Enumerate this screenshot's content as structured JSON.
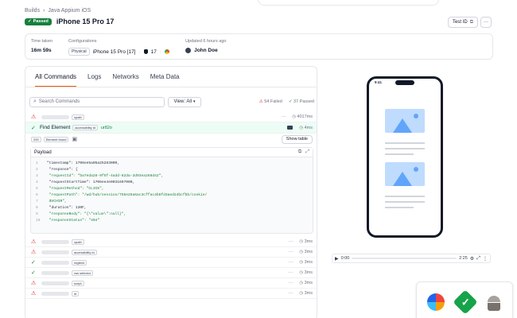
{
  "breadcrumb": {
    "root": "Builds",
    "sep": "›",
    "current": "Java Appium iOS"
  },
  "header": {
    "status": "Passed",
    "title": "iPhone 15 Pro 17",
    "test_id_label": "Test ID",
    "more": "···"
  },
  "stats": {
    "time_taken": {
      "label": "Time taken",
      "value": "16m 59s"
    },
    "configurations": {
      "label": "Configurations",
      "chip": "Physical",
      "device": "iPhone 15 Pro [17]",
      "os": "17"
    },
    "updated": {
      "label": "Updated 6 hours ago",
      "user": "John Doe"
    }
  },
  "tabs": [
    "All Commands",
    "Logs",
    "Networks",
    "Meta Data"
  ],
  "toolbar": {
    "search_placeholder": "Search Commands",
    "view_label": "View: All",
    "failed": "54 Failed",
    "passed": "37 Passed"
  },
  "colors": {
    "accent": "#ea580c",
    "pass": "#15803d",
    "fail": "#dc2626"
  },
  "rows_top": [
    {
      "status": "fail",
      "tag": "xpath",
      "time": "4017ms"
    }
  ],
  "highlight_row": {
    "status": "pass",
    "label": "Find Element",
    "tag": "accessibility id",
    "value": "ur82o",
    "time": "4ms"
  },
  "element_sub": {
    "status_code": "200",
    "chip": "Element found",
    "show_table": "Show table"
  },
  "payload": {
    "title": "Payload",
    "lines": [
      {
        "n": "1",
        "t": "\"timestamp\": 1706ee5a05a25283000,"
      },
      {
        "n": "2",
        "t": "  \"response\": {"
      },
      {
        "n": "3",
        "t": "    \"requestId\": \"ba7eda28-9f5f-4add-82da-3d93ea268d42\","
      },
      {
        "n": "4",
        "t": "    \"requestStartTime\": 1706ee4e0031697000,"
      },
      {
        "n": "5",
        "t": "    \"requestMethod\": \"CLICK\","
      },
      {
        "n": "6",
        "t": "    \"requestPath\": \"/wd/hub/session/755e26a6ac3cffac4b6fd3aed24bcfbb/cookie/"
      },
      {
        "n": "7",
        "t": "      $VCHIR\","
      },
      {
        "n": "8",
        "t": "    \"duration\": 130F,"
      },
      {
        "n": "9",
        "t": "    \"responseBody\": \"{\\\"value\\\":null}\","
      },
      {
        "n": "10",
        "t": "    \"responseStatus\": \"404\""
      }
    ]
  },
  "rows_bottom": [
    {
      "status": "fail",
      "tag": "xpath",
      "time": "3ms"
    },
    {
      "status": "fail",
      "tag": "accessibility id",
      "time": "3ms"
    },
    {
      "status": "pass",
      "tag": "regtech",
      "time": "3ms"
    },
    {
      "status": "pass",
      "tag": "css selector",
      "time": "3ms"
    },
    {
      "status": "fail",
      "tag": "script",
      "time": "3ms"
    },
    {
      "status": "fail",
      "tag": "id",
      "time": "3ms"
    }
  ],
  "device": {
    "time": "9:41"
  },
  "player": {
    "current": "0:00",
    "duration": "2:25"
  },
  "logos": [
    "lambdatest-icon",
    "check-badge-icon",
    "android-icon"
  ]
}
